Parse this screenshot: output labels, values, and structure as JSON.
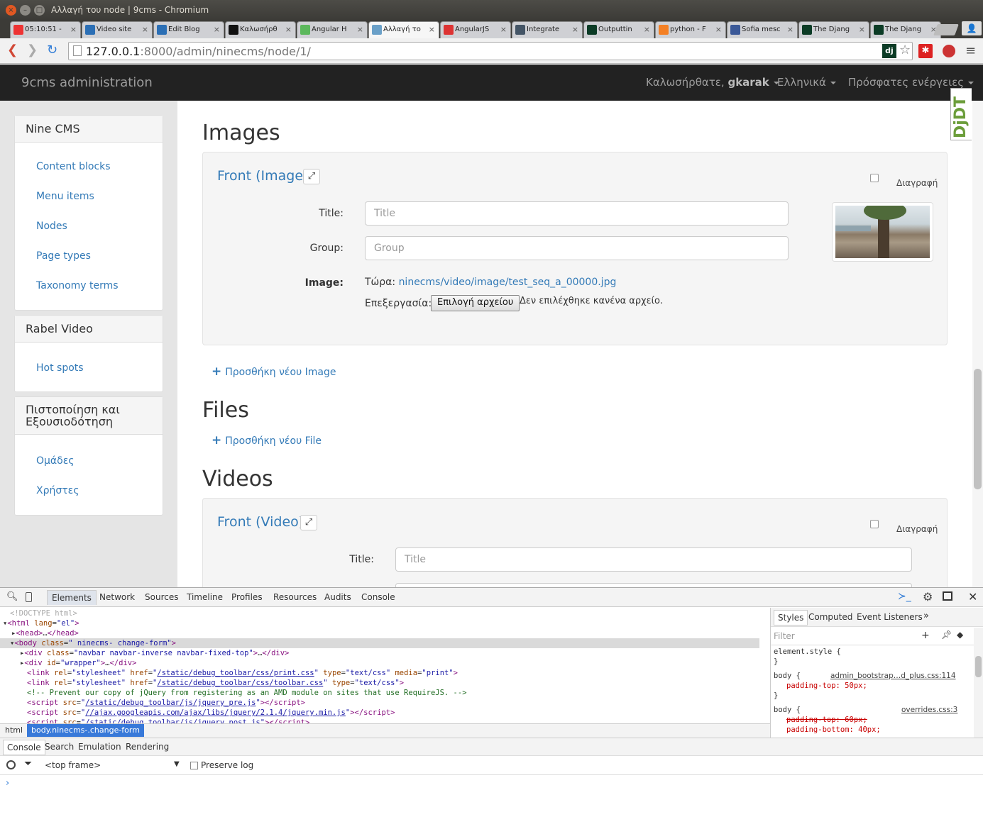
{
  "window": {
    "title": "Αλλαγή του node | 9cms - Chromium"
  },
  "tabs": [
    {
      "label": "05:10:51 -",
      "color": "#e33"
    },
    {
      "label": "Video site",
      "color": "#2b6fb5"
    },
    {
      "label": "Edit Blog",
      "color": "#2b6fb5"
    },
    {
      "label": "Καλωσήρθ",
      "color": "#111"
    },
    {
      "label": "Angular H",
      "color": "#5cb85c"
    },
    {
      "label": "Αλλαγή το",
      "color": "#6aa0c8",
      "active": true
    },
    {
      "label": "AngularJS",
      "color": "#d33"
    },
    {
      "label": "Integrate",
      "color": "#456"
    },
    {
      "label": "Outputtin",
      "color": "#0c3c26"
    },
    {
      "label": "python - F",
      "color": "#f48024"
    },
    {
      "label": "Sofia mesc",
      "color": "#3b5998"
    },
    {
      "label": "The Djang",
      "color": "#0c3c26"
    },
    {
      "label": "The Djang",
      "color": "#0c3c26"
    }
  ],
  "address": {
    "host": "127.0.0.1",
    "rest": ":8000/admin/ninecms/node/1/"
  },
  "navbar": {
    "brand": "9cms administration",
    "welcome_prefix": "Καλωσήρθατε,",
    "user": "gkarak",
    "language": "Ελληνικά",
    "recent": "Πρόσφατες ενέργειες"
  },
  "sidebar": {
    "ninecms": {
      "title": "Nine CMS",
      "items": [
        "Content blocks",
        "Menu items",
        "Nodes",
        "Page types",
        "Taxonomy terms"
      ]
    },
    "rabel": {
      "title": "Rabel Video",
      "items": [
        "Hot spots"
      ]
    },
    "auth": {
      "title": "Πιστοποίηση και Εξουσιοδότηση",
      "items": [
        "Ομάδες",
        "Χρήστες"
      ]
    }
  },
  "main": {
    "images": {
      "heading": "Images",
      "front": "Front",
      "type": "(Image)",
      "delete": "Διαγραφή",
      "title_label": "Title:",
      "title_placeholder": "Title",
      "group_label": "Group:",
      "group_placeholder": "Group",
      "image_label": "Image:",
      "now_label": "Τώρα:",
      "now_link": "ninecms/video/image/test_seq_a_00000.jpg",
      "edit_label": "Επεξεργασία:",
      "choose_button": "Επιλογή αρχείου",
      "no_file": "Δεν επιλέχθηκε κανένα αρχείο.",
      "add": "Προσθήκη νέου Image"
    },
    "files": {
      "heading": "Files",
      "add": "Προσθήκη νέου File"
    },
    "videos": {
      "heading": "Videos",
      "front": "Front",
      "type": "(Video)",
      "delete": "Διαγραφή",
      "title_label": "Title:",
      "title_placeholder": "Title"
    }
  },
  "devtools": {
    "tabs": [
      "Elements",
      "Network",
      "Sources",
      "Timeline",
      "Profiles",
      "Resources",
      "Audits",
      "Console"
    ],
    "breadcrumb": [
      "html",
      "body.ninecms-.change-form"
    ],
    "styles_tabs": [
      "Styles",
      "Computed",
      "Event Listeners"
    ],
    "filter_placeholder": "Filter",
    "drawer_tabs": [
      "Console",
      "Search",
      "Emulation",
      "Rendering"
    ],
    "frame": "<top frame>",
    "preserve_log": "Preserve log",
    "styles": {
      "element_style": "element.style {",
      "r1_sel": "body {",
      "r1_src": "admin_bootstrap…d_plus.css:114",
      "r1_prop": "padding-top: 50px;",
      "r2_sel": "body {",
      "r2_src": "overrides.css:3",
      "r2_prop1": "padding-top: 60px;",
      "r2_prop2": "padding-bottom: 40px;"
    }
  }
}
